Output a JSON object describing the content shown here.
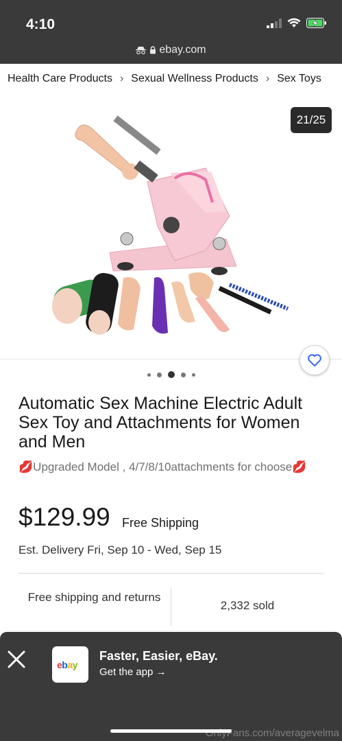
{
  "status_bar": {
    "time": "4:10",
    "url": "ebay.com"
  },
  "breadcrumb": [
    "Health Care Products",
    "Sexual Wellness Products",
    "Sex Toys"
  ],
  "gallery": {
    "counter": "21/25",
    "dots_count": 5,
    "active_dot": 2
  },
  "listing": {
    "title": "Automatic Sex Machine Electric Adult Sex Toy and Attachments for Women and Men",
    "subtitle": "💋Upgraded Model , 4/7/8/10attachments for choose💋",
    "price": "$129.99",
    "shipping": "Free Shipping",
    "delivery": "Est. Delivery Fri, Sep 10 - Wed, Sep 15",
    "feature_left": "Free shipping and returns",
    "feature_right": "2,332 sold"
  },
  "app_banner": {
    "title": "Faster, Easier, eBay.",
    "subtitle": "Get the app",
    "logo_text": "ebay"
  },
  "watermark": "OnlyFans.com/averagevelma",
  "colors": {
    "status_bg": "#3a3a3a",
    "heart_blue": "#3665f3",
    "ebay_red": "#e53238",
    "ebay_blue": "#0064d2",
    "ebay_yellow": "#f5af02",
    "ebay_green": "#86b817"
  }
}
